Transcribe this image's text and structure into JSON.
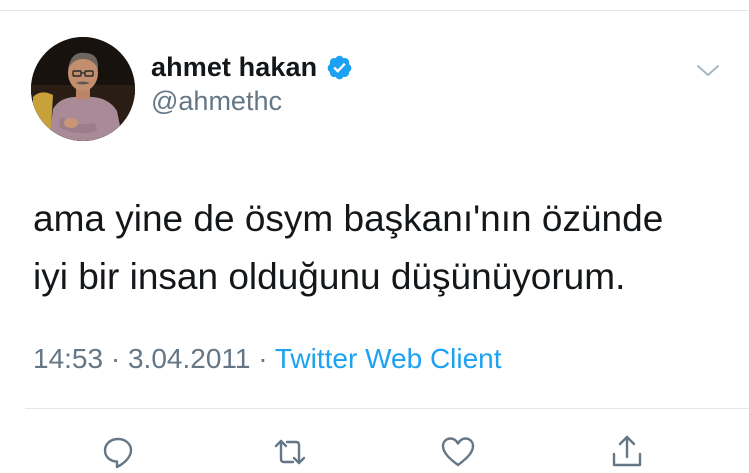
{
  "tweet": {
    "author": {
      "display_name": "ahmet hakan",
      "handle": "@ahmethc",
      "verified": true,
      "avatar_icon": "profile-photo"
    },
    "text": "ama yine de ösym başkanı'nın özünde\niyi bir insan olduğunu düşünüyorum.",
    "meta": {
      "time": "14:53",
      "separator": "·",
      "date": "3.04.2011",
      "source": "Twitter Web Client"
    },
    "actions": [
      {
        "name": "reply",
        "icon": "reply-icon"
      },
      {
        "name": "retweet",
        "icon": "retweet-icon"
      },
      {
        "name": "like",
        "icon": "heart-icon"
      },
      {
        "name": "share",
        "icon": "share-icon"
      }
    ]
  },
  "colors": {
    "accent": "#1da1f2",
    "muted": "#657786",
    "text": "#14171a",
    "divider": "#e1e8ed"
  }
}
